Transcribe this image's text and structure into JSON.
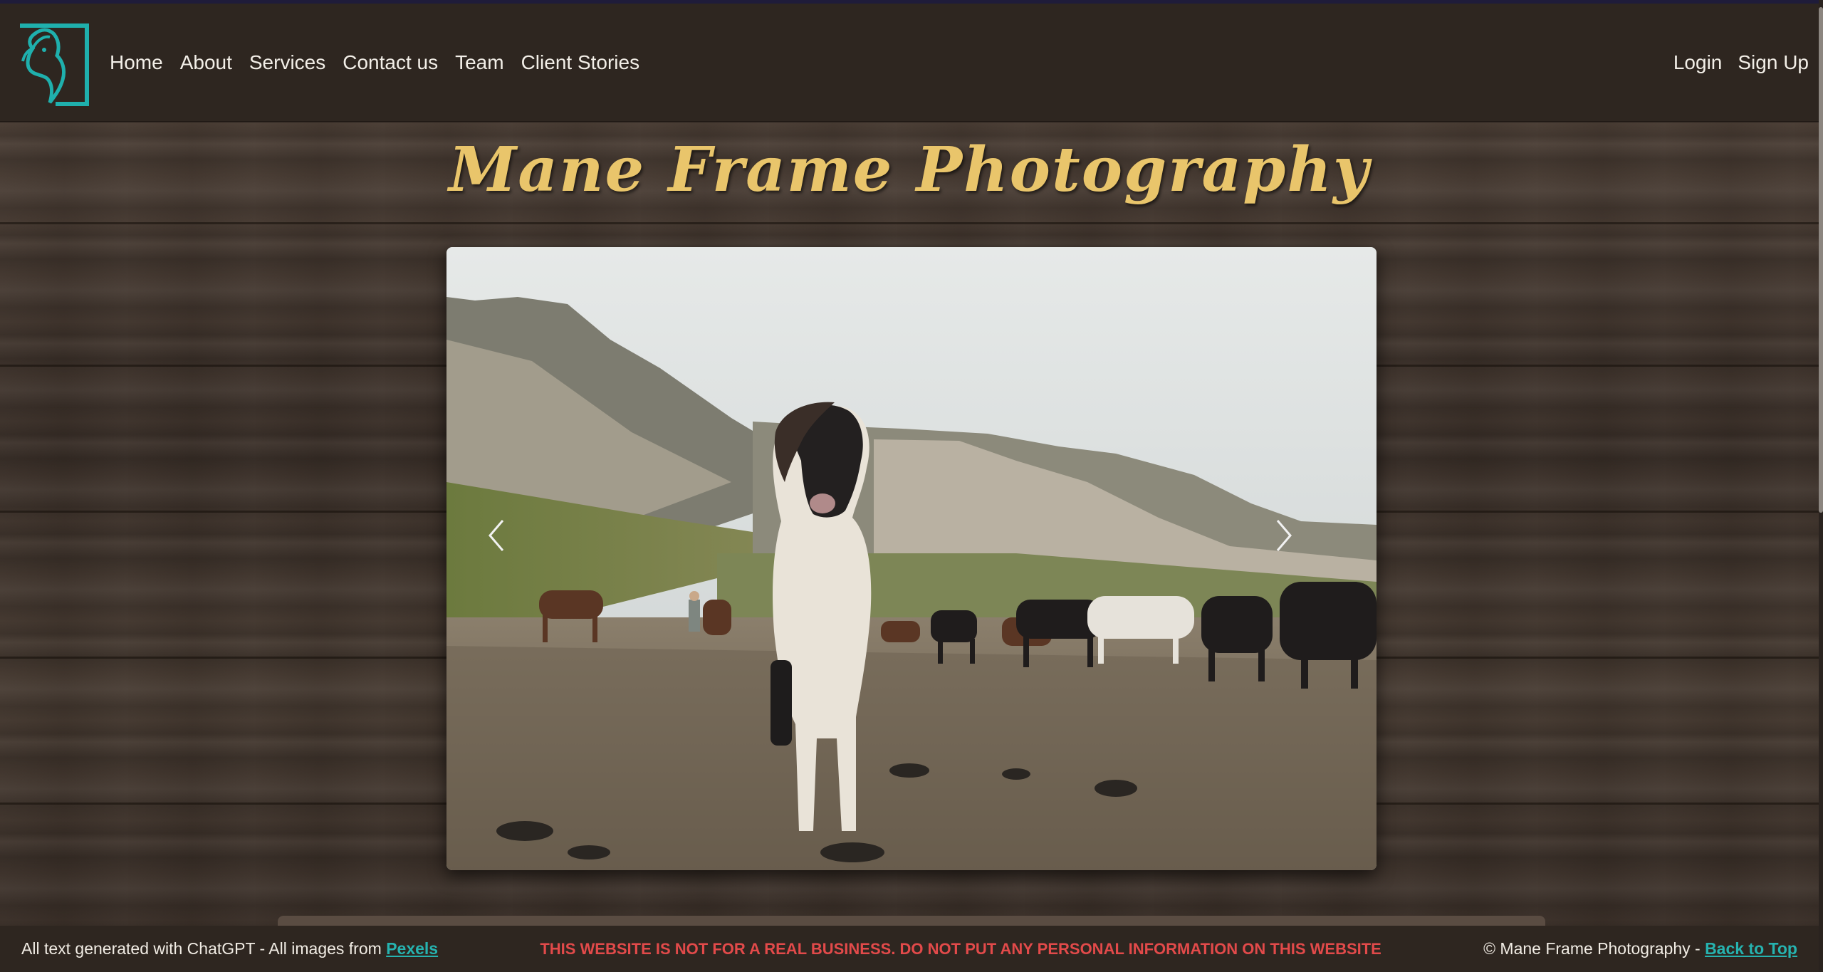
{
  "header": {
    "logo_icon": "horse-head-logo-icon",
    "nav": [
      "Home",
      "About",
      "Services",
      "Contact us",
      "Team",
      "Client Stories"
    ],
    "auth": {
      "login": "Login",
      "signup": "Sign Up"
    }
  },
  "hero": {
    "title": "Mane Frame Photography"
  },
  "carousel": {
    "prev_icon": "chevron-left-icon",
    "next_icon": "chevron-right-icon"
  },
  "footer": {
    "credit_prefix": "All text generated with ChatGPT - All images from ",
    "credit_link": "Pexels",
    "warning": "THIS WEBSITE IS NOT FOR A REAL BUSINESS. DO NOT PUT ANY PERSONAL INFORMATION ON THIS WEBSITE",
    "copyright": "© Mane Frame Photography - ",
    "back_to_top": "Back to Top"
  },
  "colors": {
    "accent_teal": "#26b3b0",
    "title_gold": "#e9c56b",
    "warning_red": "#e24a4a",
    "header_bg": "#2e2620"
  }
}
